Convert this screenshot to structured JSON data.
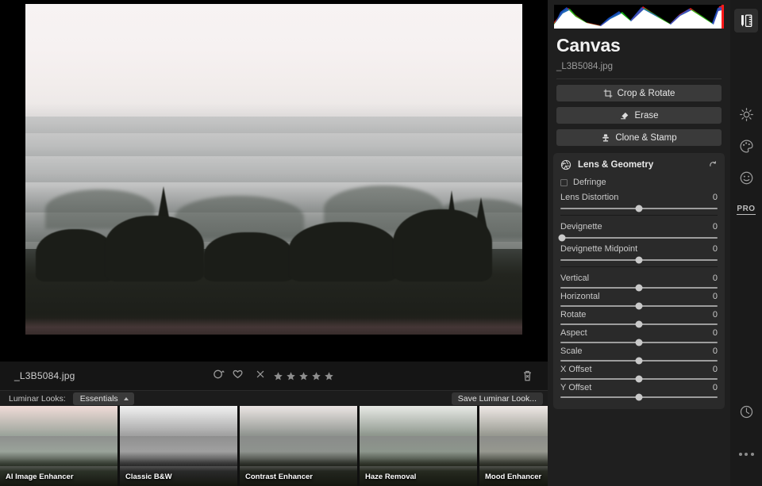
{
  "app": {
    "panel_title": "Canvas",
    "file_name": "_L3B5084.jpg"
  },
  "histogram": {
    "icon": "histogram-rgb"
  },
  "tools": [
    {
      "label": "Crop & Rotate",
      "icon": "crop-icon"
    },
    {
      "label": "Erase",
      "icon": "eraser-icon"
    },
    {
      "label": "Clone & Stamp",
      "icon": "stamp-icon"
    }
  ],
  "lens_section": {
    "title": "Lens & Geometry",
    "icon": "aperture-icon",
    "reset_icon": "reset-arrow-icon",
    "checkbox": {
      "label": "Defringe",
      "checked": false
    },
    "sliders_group1": [
      {
        "label": "Lens Distortion",
        "value": "0",
        "pos": 50
      }
    ],
    "sliders_group2": [
      {
        "label": "Devignette",
        "value": "0",
        "pos": 1
      },
      {
        "label": "Devignette Midpoint",
        "value": "0",
        "pos": 50
      }
    ],
    "sliders_group3": [
      {
        "label": "Vertical",
        "value": "0",
        "pos": 50
      },
      {
        "label": "Horizontal",
        "value": "0",
        "pos": 50
      },
      {
        "label": "Rotate",
        "value": "0",
        "pos": 50
      },
      {
        "label": "Aspect",
        "value": "0",
        "pos": 50
      },
      {
        "label": "Scale",
        "value": "0",
        "pos": 50
      },
      {
        "label": "X Offset",
        "value": "0",
        "pos": 50
      },
      {
        "label": "Y Offset",
        "value": "0",
        "pos": 50
      }
    ]
  },
  "info_bar": {
    "file_name": "_L3B5084.jpg",
    "color_label_icon": "color-label-icon",
    "favorite_icon": "heart-icon",
    "reject_icon": "reject-x-icon",
    "stars": 5,
    "stars_filled": 0,
    "delete_icon": "trash-icon"
  },
  "looks_bar": {
    "label": "Luminar Looks:",
    "selected": "Essentials",
    "save_label": "Save Luminar Look..."
  },
  "presets": [
    {
      "label": "AI Image Enhancer",
      "sky": "#f0dcd8",
      "mid": "#9aa39a",
      "fg": "#2c3228"
    },
    {
      "label": "Classic B&W",
      "sky": "#f2f2f2",
      "mid": "#a0a0a0",
      "fg": "#2a2a2a"
    },
    {
      "label": "Contrast Enhancer",
      "sky": "#ece6e4",
      "mid": "#8e938e",
      "fg": "#23261f"
    },
    {
      "label": "Haze Removal",
      "sky": "#e8eae6",
      "mid": "#8d968c",
      "fg": "#262a20"
    },
    {
      "label": "Mood Enhancer",
      "sky": "#efe9e6",
      "mid": "#96988f",
      "fg": "#272a22"
    }
  ],
  "rail": [
    {
      "name": "edit-tools-icon",
      "active": true
    },
    {
      "name": "light-icon",
      "active": false
    },
    {
      "name": "color-palette-icon",
      "active": false
    },
    {
      "name": "portrait-icon",
      "active": false
    },
    {
      "name": "pro-label",
      "label": "PRO",
      "active": false
    },
    {
      "name": "history-icon",
      "active": false
    },
    {
      "name": "more-options-icon",
      "active": false
    }
  ]
}
